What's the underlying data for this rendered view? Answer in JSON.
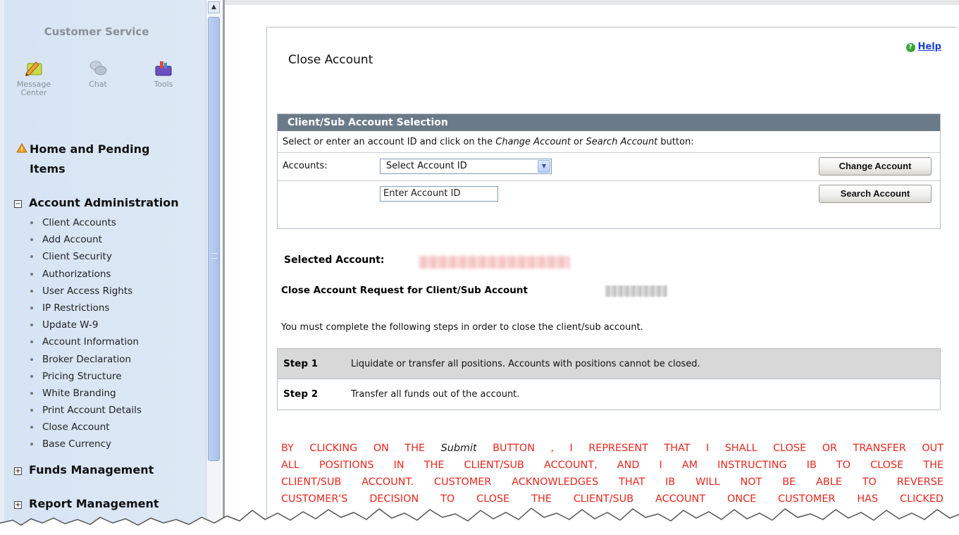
{
  "sidebar": {
    "title": "Customer Service",
    "tools": [
      {
        "label_line1": "Message",
        "label_line2": "Center",
        "icon": "message-center-icon"
      },
      {
        "label_line1": "Chat",
        "label_line2": "",
        "icon": "chat-icon"
      },
      {
        "label_line1": "Tools",
        "label_line2": "",
        "icon": "tools-icon"
      }
    ],
    "home": {
      "label_line1": "Home and Pending",
      "label_line2": "Items",
      "icon": "warning-icon"
    },
    "account_admin": {
      "label": "Account Administration",
      "expanded": true,
      "items": [
        "Client Accounts",
        "Add Account",
        "Client Security",
        "Authorizations",
        "User Access Rights",
        "IP Restrictions",
        "Update W-9",
        "Account Information",
        "Broker Declaration",
        "Pricing Structure",
        "White Branding",
        "Print Account Details",
        "Close Account",
        "Base Currency"
      ]
    },
    "funds": {
      "label": "Funds Management",
      "expanded": false
    },
    "report": {
      "label": "Report Management",
      "expanded": false
    }
  },
  "main": {
    "title": "Close Account",
    "help_label": "Help",
    "panel": {
      "header": "Client/Sub Account Selection",
      "instr_prefix": "Select or enter an account ID and click on the ",
      "instr_em1": "Change Account",
      "instr_mid": " or ",
      "instr_em2": "Search Account",
      "instr_suffix": " button:",
      "accounts_label": "Accounts:",
      "select_value": "Select Account ID",
      "input_value": "Enter Account ID",
      "change_button": "Change Account",
      "search_button": "Search Account"
    },
    "selected_account_label": "Selected Account:",
    "close_request_label": "Close Account Request for Client/Sub Account",
    "must_complete": "You must complete the following steps in order to close the client/sub account.",
    "steps": [
      {
        "label": "Step 1",
        "text": "Liquidate or transfer all positions. Accounts with positions cannot be closed."
      },
      {
        "label": "Step 2",
        "text": "Transfer all funds out of the account."
      }
    ],
    "disclaimer": {
      "l1_pre": "BY CLICKING ON THE ",
      "l1_em": "Submit",
      "l1_post": " BUTTON , I REPRESENT THAT I SHALL CLOSE OR TRANSFER OUT",
      "l2": "ALL POSITIONS IN THE CLIENT/SUB ACCOUNT, AND I AM INSTRUCTING IB TO CLOSE THE",
      "l3": "CLIENT/SUB ACCOUNT. CUSTOMER ACKNOWLEDGES THAT IB WILL NOT BE ABLE TO REVERSE",
      "l4": "CUSTOMER'S DECISION TO CLOSE THE CLIENT/SUB ACCOUNT ONCE CUSTOMER HAS CLICKED"
    }
  },
  "colors": {
    "sidebar_bg": "#d9e6f4",
    "panel_header": "#6b7a88",
    "disclaimer_red": "#e8281f",
    "help_link": "#1a3fcf"
  }
}
